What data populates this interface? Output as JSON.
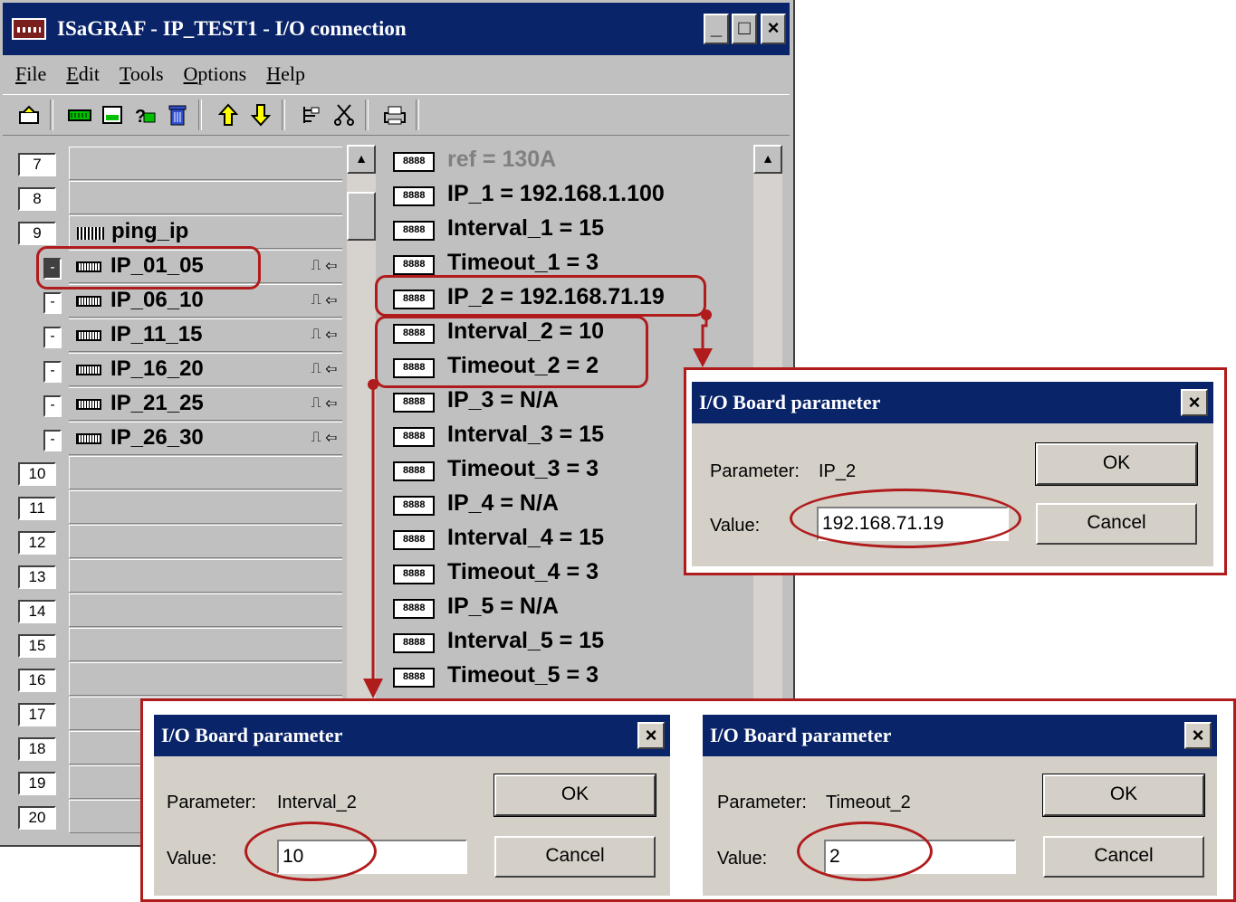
{
  "window": {
    "title": "ISaGRAF - IP_TEST1 - I/O connection",
    "controls": {
      "minimize": "_",
      "maximize": "□",
      "close": "×"
    }
  },
  "menu": [
    "File",
    "Edit",
    "Tools",
    "Options",
    "Help"
  ],
  "toolbar_icons": [
    "board-properties-icon",
    "connect-board-icon",
    "set-board-icon",
    "test-icon",
    "delete-icon",
    "move-up-icon",
    "move-down-icon",
    "list-icon",
    "cut-icon",
    "print-icon"
  ],
  "slots": [
    {
      "num": "7",
      "label": ""
    },
    {
      "num": "8",
      "label": ""
    },
    {
      "num": "9",
      "label": "ping_ip"
    },
    {
      "num": "10",
      "label": ""
    },
    {
      "num": "11",
      "label": ""
    },
    {
      "num": "12",
      "label": ""
    },
    {
      "num": "13",
      "label": ""
    },
    {
      "num": "14",
      "label": ""
    },
    {
      "num": "15",
      "label": ""
    },
    {
      "num": "16",
      "label": ""
    },
    {
      "num": "17",
      "label": ""
    },
    {
      "num": "18",
      "label": ""
    },
    {
      "num": "19",
      "label": ""
    },
    {
      "num": "20",
      "label": ""
    }
  ],
  "boards": [
    {
      "mark": "-",
      "label": "IP_01_05",
      "sym": "⎍ ⇦"
    },
    {
      "mark": "-",
      "label": "IP_06_10",
      "sym": "⎍ ⇦"
    },
    {
      "mark": "-",
      "label": "IP_11_15",
      "sym": "⎍ ⇦"
    },
    {
      "mark": "-",
      "label": "IP_16_20",
      "sym": "⎍ ⇦"
    },
    {
      "mark": "-",
      "label": "IP_21_25",
      "sym": "⎍ ⇦"
    },
    {
      "mark": "-",
      "label": "IP_26_30",
      "sym": "⎍ ⇦"
    }
  ],
  "params": [
    {
      "chip": "8888",
      "text": "ref = 130A"
    },
    {
      "chip": "8888",
      "text": "IP_1 = 192.168.1.100"
    },
    {
      "chip": "8888",
      "text": "Interval_1 = 15"
    },
    {
      "chip": "8888",
      "text": "Timeout_1 = 3"
    },
    {
      "chip": "8888",
      "text": "IP_2 = 192.168.71.19"
    },
    {
      "chip": "8888",
      "text": "Interval_2 = 10"
    },
    {
      "chip": "8888",
      "text": "Timeout_2 = 2"
    },
    {
      "chip": "8888",
      "text": "IP_3 = N/A"
    },
    {
      "chip": "8888",
      "text": "Interval_3 = 15"
    },
    {
      "chip": "8888",
      "text": "Timeout_3 = 3"
    },
    {
      "chip": "8888",
      "text": "IP_4 = N/A"
    },
    {
      "chip": "8888",
      "text": "Interval_4 = 15"
    },
    {
      "chip": "8888",
      "text": "Timeout_4 = 3"
    },
    {
      "chip": "8888",
      "text": "IP_5 = N/A"
    },
    {
      "chip": "8888",
      "text": "Interval_5 = 15"
    },
    {
      "chip": "8888",
      "text": "Timeout_5 = 3"
    }
  ],
  "dialogs": [
    {
      "title": "I/O Board parameter",
      "param_label": "Parameter:",
      "param_name": "IP_2",
      "value_label": "Value:",
      "value": "192.168.71.19",
      "ok": "OK",
      "cancel": "Cancel",
      "close": "×"
    },
    {
      "title": "I/O Board parameter",
      "param_label": "Parameter:",
      "param_name": "Interval_2",
      "value_label": "Value:",
      "value": "10",
      "ok": "OK",
      "cancel": "Cancel",
      "close": "×"
    },
    {
      "title": "I/O Board parameter",
      "param_label": "Parameter:",
      "param_name": "Timeout_2",
      "value_label": "Value:",
      "value": "2",
      "ok": "OK",
      "cancel": "Cancel",
      "close": "×"
    }
  ],
  "colors": {
    "titlebar": "#0a246a",
    "window_bg": "#c0c0c0",
    "annotation": "#b01c1c"
  }
}
